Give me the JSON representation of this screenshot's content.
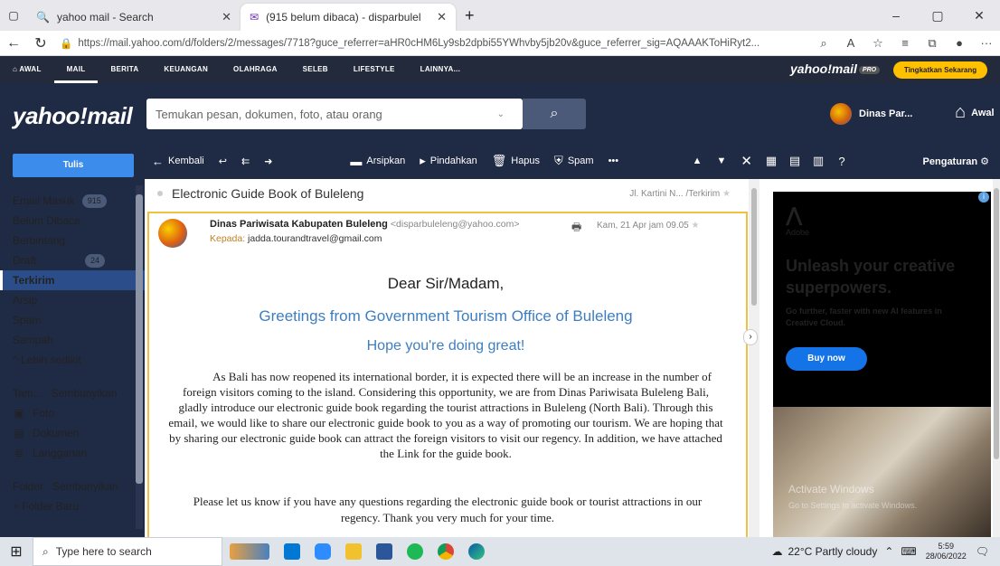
{
  "browser": {
    "tabs": [
      {
        "title": "yahoo mail - Search",
        "active": false
      },
      {
        "title": "(915 belum dibaca) - disparbulel",
        "active": true
      }
    ],
    "new_tab": "+",
    "url": "https://mail.yahoo.com/d/folders/2/messages/7718?guce_referrer=aHR0cHM6Ly9sb2dpbi55YWhvby5jb20v&guce_referrer_sig=AQAAAKToHiRyt2...",
    "win_min": "–",
    "win_max": "▢",
    "win_close": "✕"
  },
  "topnav": {
    "items": [
      "AWAL",
      "MAIL",
      "BERITA",
      "KEUANGAN",
      "OLAHRAGA",
      "SELEB",
      "LIFESTYLE",
      "LAINNYA..."
    ],
    "selected": "MAIL",
    "logo_text": "yahoo!mail",
    "pro_badge": "PRO",
    "upgrade_label": "Tingkatkan Sekarang"
  },
  "header": {
    "brand": "yahoo!mail",
    "search_placeholder": "Temukan pesan, dokumen, foto, atau orang",
    "user_name": "Dinas Par...",
    "home_label": "Awal"
  },
  "sidebar": {
    "compose_label": "Tulis",
    "folders": [
      {
        "label": "Email Masuk",
        "count": "915"
      },
      {
        "label": "Belum Dibaca",
        "count": ""
      },
      {
        "label": "Berbintang",
        "count": ""
      },
      {
        "label": "Draft",
        "count": "24"
      },
      {
        "label": "Terkirim",
        "count": "",
        "selected": true
      },
      {
        "label": "Arsip",
        "count": ""
      },
      {
        "label": "Spam",
        "count": ""
      },
      {
        "label": "Sampah",
        "count": ""
      },
      {
        "label": "^ Lebih sedikit",
        "count": ""
      }
    ],
    "views_header": "Tam...",
    "views_hide": "Sembunyikan",
    "views": [
      "Foto",
      "Dokumen",
      "Langganan"
    ],
    "folders_header": "Folder",
    "folders_hide": "Sembunyikan",
    "new_folder": "+ Folder Baru"
  },
  "toolbar": {
    "back": "Kembali",
    "archive": "Arsipkan",
    "move": "Pindahkan",
    "delete": "Hapus",
    "spam": "Spam",
    "more": "•••"
  },
  "rightpanel": {
    "settings_label": "Pengaturan"
  },
  "message": {
    "subject": "Electronic Guide Book of Buleleng",
    "subject_meta": "Jl. Kartini N... /Terkirim",
    "sender_name": "Dinas Pariwisata Kabupaten Buleleng",
    "sender_email": "<disparbuleleng@yahoo.com>",
    "to_label": "Kepada:",
    "to_value": "jadda.tourandtravel@gmail.com",
    "date": "Kam, 21 Apr jam 09.05",
    "greeting": "Dear Sir/Madam,",
    "line2": "Greetings from Government Tourism Office of Buleleng",
    "line3": "Hope you're doing great!",
    "para1": "As Bali has now reopened its international border, it is expected there will be an increase in the number of foreign visitors coming to the island. Considering this opportunity, we are from Dinas Pariwisata Buleleng Bali, gladly introduce our electronic guide book regarding the tourist attractions in Buleleng (North Bali). Through this email, we would like to share our electronic guide book to you as a way of promoting our tourism. We are hoping that by sharing our electronic guide book can attract the foreign visitors to visit our regency. In addition, we have attached the Link for the guide book.",
    "para2": "Please let us know if you have any questions regarding the electronic guide book or tourist attractions in our regency. Thank you very much for your time."
  },
  "ad": {
    "brand": "Adobe",
    "headline": "Unleash your creative superpowers.",
    "sub": "Go further, faster with new AI features in Creative Cloud.",
    "cta": "Buy now",
    "watermark1": "Activate Windows",
    "watermark2": "Go to Settings to activate Windows."
  },
  "taskbar": {
    "search_placeholder": "Type here to search",
    "weather": "22°C  Partly cloudy",
    "time": "5:59",
    "date": "28/06/2022"
  }
}
